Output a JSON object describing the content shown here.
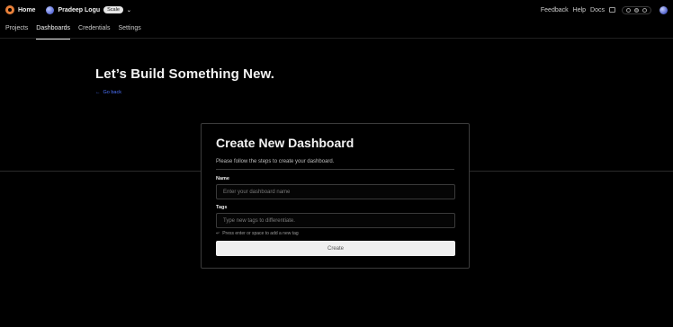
{
  "topbar": {
    "home_label": "Home",
    "user_name": "Pradeep Logu",
    "plan_badge": "Scale",
    "links": [
      "Feedback",
      "Help",
      "Docs"
    ]
  },
  "tabs": [
    {
      "label": "Projects",
      "active": false
    },
    {
      "label": "Dashboards",
      "active": true
    },
    {
      "label": "Credentials",
      "active": false
    },
    {
      "label": "Settings",
      "active": false
    }
  ],
  "hero": {
    "title": "Let’s Build Something New.",
    "back_label": "Go back"
  },
  "card": {
    "title": "Create New Dashboard",
    "subtitle": "Please follow the steps to create your dashboard.",
    "name_label": "Name",
    "name_placeholder": "Enter your dashboard name",
    "tags_label": "Tags",
    "tags_placeholder": "Type new tags to differentiate.",
    "tags_hint": "Press enter or space to add a new tag",
    "submit_label": "Create"
  },
  "colors": {
    "background": "#000000",
    "accent_link": "#4d73ff",
    "logo": "#e8803a"
  }
}
